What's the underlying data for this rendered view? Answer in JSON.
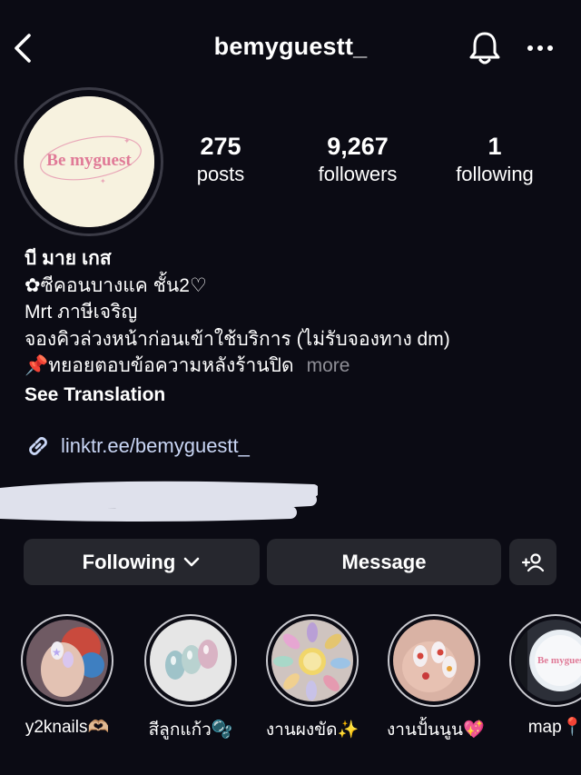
{
  "header": {
    "username": "bemyguestt_",
    "back_icon": "chevron-left-icon",
    "bell_icon": "bell-icon",
    "more_icon": "more-horizontal-icon"
  },
  "avatar": {
    "logo_text": "Be myguest"
  },
  "stats": [
    {
      "value": "275",
      "label": "posts"
    },
    {
      "value": "9,267",
      "label": "followers"
    },
    {
      "value": "1",
      "label": "following"
    }
  ],
  "bio": {
    "name": "บี มาย เกส",
    "lines": [
      "✿ซีคอนบางแค ชั้น2♡",
      "Mrt ภาษีเจริญ",
      "จองคิวล่วงหน้าก่อนเข้าใช้บริการ (ไม่รับจองทาง dm)",
      "📌ทยอยตอบข้อความหลังร้านปิด"
    ],
    "more_label": "more",
    "see_translation": "See Translation"
  },
  "link": {
    "text": "linktr.ee/bemyguestt_",
    "icon": "link-icon"
  },
  "actions": {
    "following_label": "Following",
    "message_label": "Message",
    "add_user_icon": "add-user-icon"
  },
  "highlights": [
    {
      "label": "y2knails🫶🏼"
    },
    {
      "label": "สีลูกแก้ว🫧"
    },
    {
      "label": "งานผงขัด✨"
    },
    {
      "label": "งานปั้นนูน💖"
    },
    {
      "label": "map📍"
    }
  ],
  "colors": {
    "background": "#0b0b14",
    "button": "#26272e",
    "link": "#c9d6f5",
    "muted": "#8e8e96",
    "logo_pink": "#e07a97"
  }
}
